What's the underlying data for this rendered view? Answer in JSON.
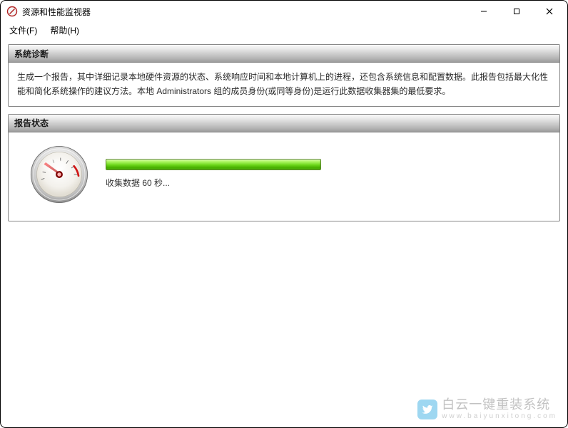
{
  "window": {
    "title": "资源和性能监视器"
  },
  "menu": {
    "file": "文件(F)",
    "help": "帮助(H)"
  },
  "sections": {
    "diagnostics": {
      "title": "系统诊断",
      "body": "生成一个报告，其中详细记录本地硬件资源的状态、系统响应时间和本地计算机上的进程，还包含系统信息和配置数据。此报告包括最大化性能和简化系统操作的建议方法。本地 Administrators 组的成员身份(或同等身份)是运行此数据收集器集的最低要求。"
    },
    "status": {
      "title": "报告状态",
      "text": "收集数据 60 秒..."
    }
  },
  "watermark": {
    "main": "白云一键重装系统",
    "sub": "www.baiyunxitong.com"
  }
}
